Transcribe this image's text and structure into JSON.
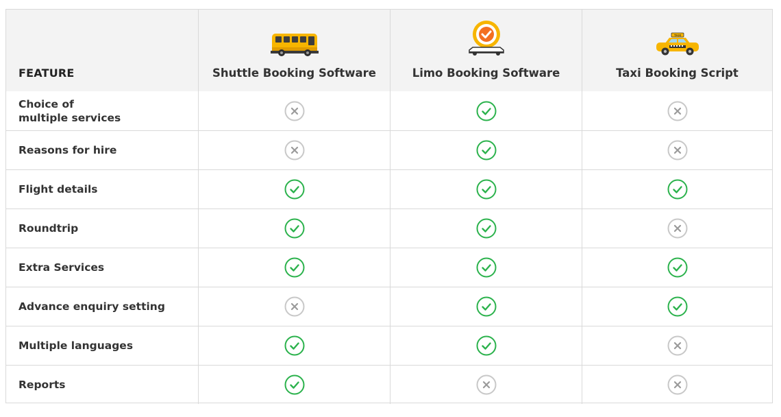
{
  "header": {
    "feature_label": "FEATURE",
    "products": [
      {
        "name": "Shuttle Booking Software",
        "icon": "shuttle-bus-icon"
      },
      {
        "name": "Limo Booking Software",
        "icon": "limo-check-icon"
      },
      {
        "name": "Taxi Booking Script",
        "icon": "taxi-icon"
      }
    ]
  },
  "colors": {
    "check": "#2bb24c",
    "cross": "#c8c8c8",
    "header_bg": "#f3f3f3",
    "border": "#d9d9d9"
  },
  "rows": [
    {
      "feature": "Choice of\nmultiple services",
      "values": [
        false,
        true,
        false
      ]
    },
    {
      "feature": "Reasons for hire",
      "values": [
        false,
        true,
        false
      ]
    },
    {
      "feature": "Flight details",
      "values": [
        true,
        true,
        true
      ]
    },
    {
      "feature": "Roundtrip",
      "values": [
        true,
        true,
        false
      ]
    },
    {
      "feature": "Extra Services",
      "values": [
        true,
        true,
        true
      ]
    },
    {
      "feature": "Advance enquiry setting",
      "values": [
        false,
        true,
        true
      ]
    },
    {
      "feature": "Multiple languages",
      "values": [
        true,
        true,
        false
      ]
    },
    {
      "feature": "Reports",
      "values": [
        true,
        false,
        false
      ]
    }
  ]
}
